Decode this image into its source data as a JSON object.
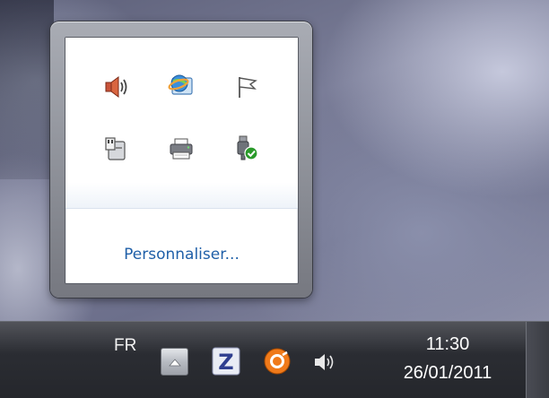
{
  "tray_popup": {
    "icons": [
      {
        "name": "volume-muted-icon"
      },
      {
        "name": "network-globe-icon"
      },
      {
        "name": "action-center-flag-icon"
      },
      {
        "name": "removable-device-icon"
      },
      {
        "name": "printer-icon"
      },
      {
        "name": "safely-remove-hardware-icon"
      }
    ],
    "customize_label": "Personnaliser..."
  },
  "taskbar": {
    "language": "FR",
    "icons": [
      "show-hidden-icons-icon",
      "z-app-icon",
      "avast-icon",
      "speaker-icon"
    ],
    "clock": {
      "time": "11:30",
      "date": "26/01/2011"
    }
  },
  "colors": {
    "link": "#1f5fa8",
    "taskbar": "#2b2d33",
    "check_green": "#2a9a2a"
  }
}
